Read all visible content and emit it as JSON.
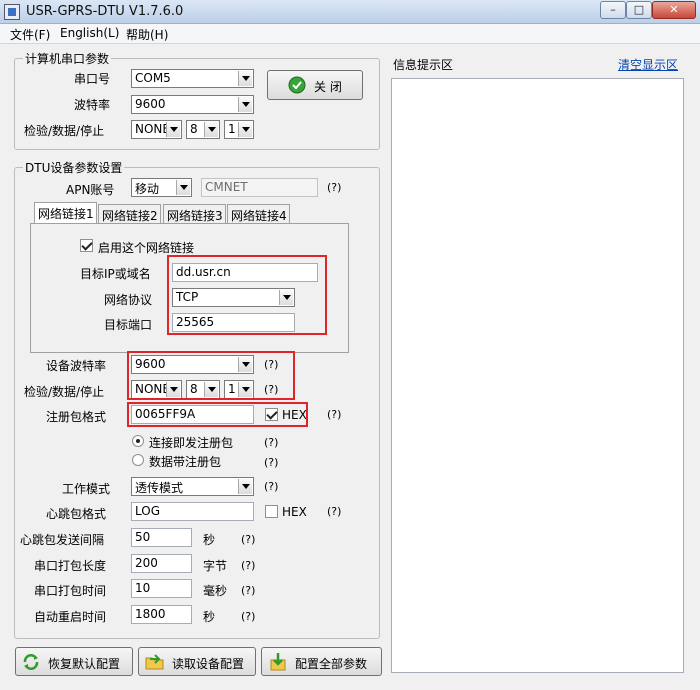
{
  "window": {
    "title": "USR-GPRS-DTU V1.7.6.0"
  },
  "titlebar_buttons": {
    "minimize": "–",
    "maximize": "□",
    "close": "✕"
  },
  "menu": [
    "文件(F)",
    "English(L)",
    "帮助(H)"
  ],
  "serial": {
    "legend": "计算机串口参数",
    "port_label": "串口号",
    "port_value": "COM5",
    "baud_label": "波特率",
    "baud_value": "9600",
    "check_label": "检验/数据/停止",
    "parity": "NONE",
    "databits": "8",
    "stopbits": "1",
    "close_button": "关 闭"
  },
  "dtu": {
    "legend": "DTU设备参数设置",
    "apn_label": "APN账号",
    "apn_value": "移动",
    "apn_name": "CMNET",
    "apn_q": "(?)",
    "tabs": [
      "网络链接1",
      "网络链接2",
      "网络链接3",
      "网络链接4"
    ],
    "enable_label": "启用这个网络链接",
    "ip_label": "目标IP或域名",
    "ip_value": "dd.usr.cn",
    "proto_label": "网络协议",
    "proto_value": "TCP",
    "port_label": "目标端口",
    "port_value": "25565",
    "dev_baud_label": "设备波特率",
    "dev_baud_value": "9600",
    "dev_baud_q": "(?)",
    "dev_check_label": "检验/数据/停止",
    "dev_parity": "NONE",
    "dev_databits": "8",
    "dev_stopbits": "1",
    "dev_check_q": "(?)",
    "reg_label": "注册包格式",
    "reg_value": "0065FF9A",
    "reg_hex_label": "HEX",
    "reg_q": "(?)",
    "radio1_label": "连接即发注册包",
    "radio1_q": "(?)",
    "radio2_label": "数据带注册包",
    "radio2_q": "(?)",
    "mode_label": "工作模式",
    "mode_value": "透传模式",
    "mode_q": "(?)",
    "hb_label": "心跳包格式",
    "hb_value": "LOG",
    "hb_hex_label": "HEX",
    "hb_q": "(?)",
    "hb_interval_label": "心跳包发送间隔",
    "hb_interval_value": "50",
    "hb_interval_unit": "秒",
    "hb_interval_q": "(?)",
    "pack_len_label": "串口打包长度",
    "pack_len_value": "200",
    "pack_len_unit": "字节",
    "pack_len_q": "(?)",
    "pack_time_label": "串口打包时间",
    "pack_time_value": "10",
    "pack_time_unit": "毫秒",
    "pack_time_q": "(?)",
    "restart_label": "自动重启时间",
    "restart_value": "1800",
    "restart_unit": "秒",
    "restart_q": "(?)"
  },
  "bottom_buttons": [
    "恢复默认配置",
    "读取设备配置",
    "配置全部参数"
  ],
  "info_panel": {
    "title": "信息提示区",
    "clear_link": "清空显示区"
  }
}
